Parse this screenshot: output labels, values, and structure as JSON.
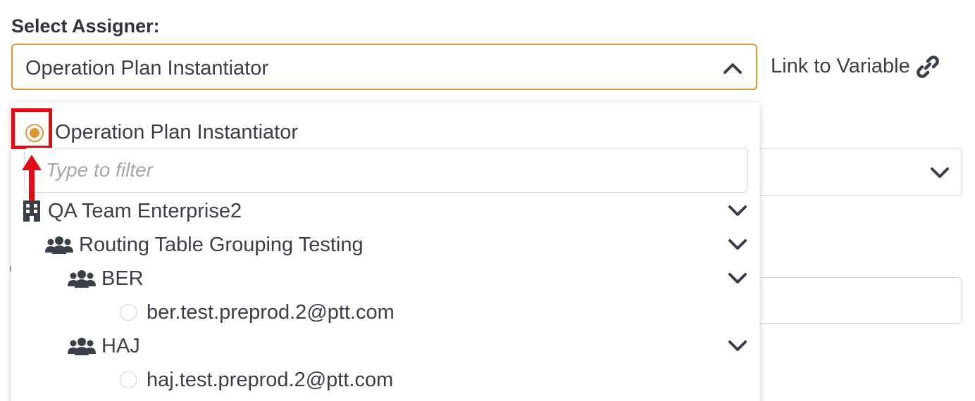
{
  "form": {
    "label": "Select Assigner:",
    "selected_value": "Operation Plan Instantiator",
    "link_to_variable": "Link to Variable"
  },
  "dropdown": {
    "selected_option": "Operation Plan Instantiator",
    "filter_placeholder": "Type to filter",
    "tree": {
      "enterprise": "QA Team Enterprise2",
      "group": "Routing Table Grouping Testing",
      "subgroup_1": "BER",
      "user_1": "ber.test.preprod.2@ptt.com",
      "subgroup_2": "HAJ",
      "user_2": "haj.test.preprod.2@ptt.com"
    }
  },
  "colors": {
    "accent": "#e0962f",
    "annotation": "#e50914",
    "text": "#3a3f47"
  }
}
